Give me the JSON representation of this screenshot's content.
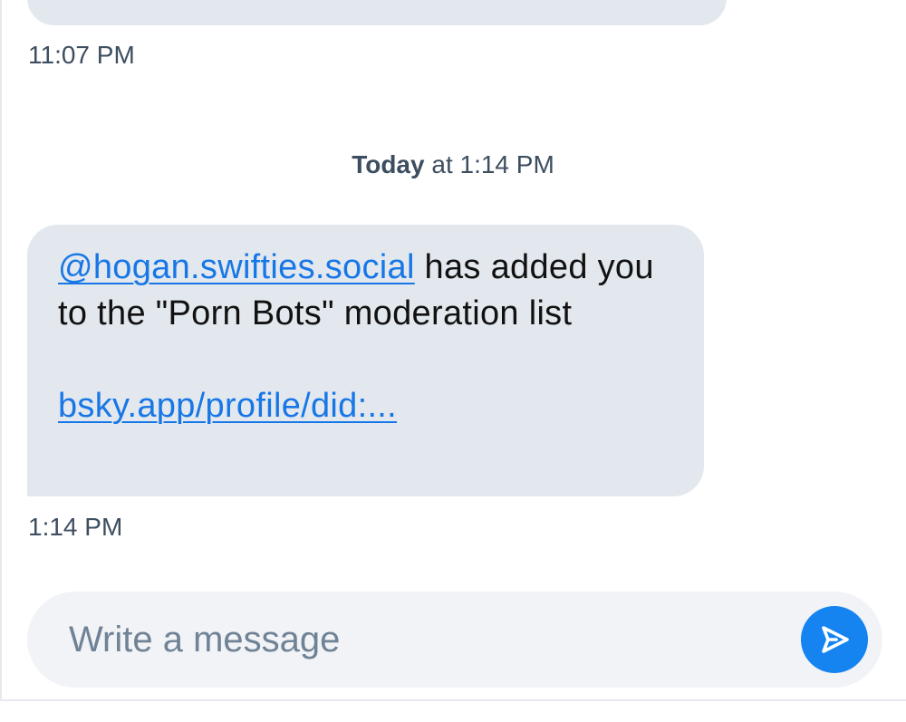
{
  "thread": {
    "previous_message_time": "11:07 PM",
    "day_separator": {
      "day": "Today",
      "rest": " at 1:14 PM"
    },
    "message": {
      "mention": "@hogan.swifties.social",
      "text_after_mention": " has added you to the \"Porn Bots\" moderation list",
      "link": "bsky.app/profile/did:...",
      "time": "1:14 PM"
    }
  },
  "composer": {
    "placeholder": "Write a message",
    "value": "",
    "send_icon": "send-icon"
  },
  "colors": {
    "bubble_background": "#e3e8ee",
    "link": "#1877e6",
    "send_button": "#1583f0",
    "timestamp_text": "#3d4e60",
    "placeholder_text": "#6f8296"
  }
}
